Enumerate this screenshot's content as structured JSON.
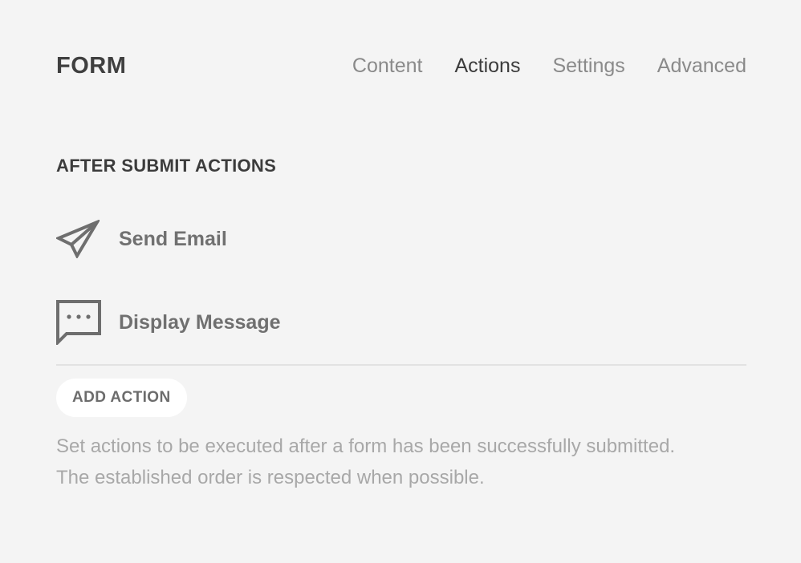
{
  "header": {
    "title": "FORM",
    "tabs": [
      {
        "label": "Content",
        "active": false
      },
      {
        "label": "Actions",
        "active": true
      },
      {
        "label": "Settings",
        "active": false
      },
      {
        "label": "Advanced",
        "active": false
      }
    ]
  },
  "actions_section": {
    "title": "AFTER SUBMIT ACTIONS",
    "items": [
      {
        "label": "Send Email",
        "icon": "paper-plane-icon"
      },
      {
        "label": "Display Message",
        "icon": "chat-bubble-dots-icon"
      }
    ],
    "add_button_label": "ADD ACTION",
    "help_text": "Set actions to be executed after a form has been successfully submitted. The established order is respected when possible."
  },
  "colors": {
    "background": "#f4f4f4",
    "title": "#3f3f3f",
    "tab_inactive": "#8a8a8a",
    "tab_active": "#3c3c3c",
    "action_label": "#707070",
    "icon": "#6e6e6e",
    "help_text": "#a8a8a8",
    "button_bg": "#ffffff"
  }
}
